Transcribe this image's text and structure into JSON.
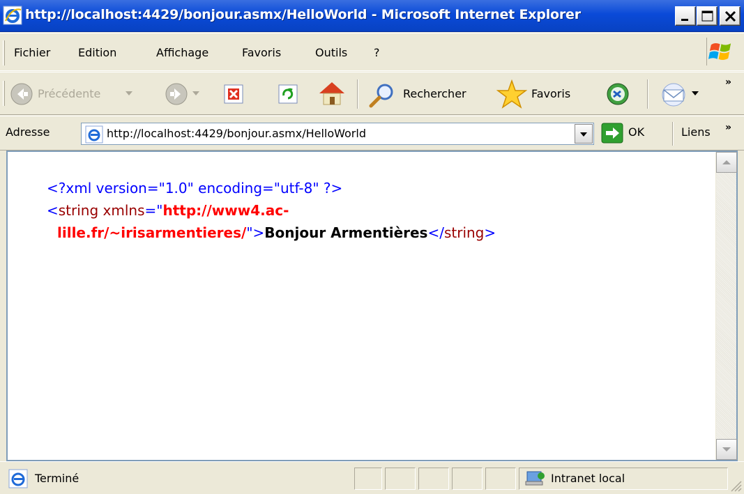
{
  "window": {
    "title": "http://localhost:4429/bonjour.asmx/HelloWorld - Microsoft Internet Explorer"
  },
  "menubar": {
    "items": [
      {
        "label": "Fichier"
      },
      {
        "label": "Edition"
      },
      {
        "label": "Affichage"
      },
      {
        "label": "Favoris"
      },
      {
        "label": "Outils"
      },
      {
        "label": "?"
      }
    ]
  },
  "toolbar": {
    "back_label": "Précédente",
    "search_label": "Rechercher",
    "favorites_label": "Favoris",
    "more_chevron": "»"
  },
  "address": {
    "label": "Adresse",
    "url": "http://localhost:4429/bonjour.asmx/HelloWorld",
    "go_label": "OK",
    "links_label": "Liens",
    "links_chevron": "»"
  },
  "content": {
    "xml_decl": "<?xml version=\"1.0\" encoding=\"utf-8\" ?>",
    "open_tag_start": "<",
    "element_name": "string",
    "attr_name": " xmlns",
    "attr_eq_quote": "=\"",
    "attr_value_part1": "http://www4.ac-",
    "attr_value_part2": "lille.fr/~irisarmentieres/",
    "attr_close_quote": "\"",
    "open_tag_end": ">",
    "text_value": "Bonjour Armentières",
    "close_tag_start": "</",
    "close_element_name": "string",
    "close_tag_end": ">"
  },
  "statusbar": {
    "status": "Terminé",
    "zone": "Intranet local"
  },
  "colors": {
    "titlebar": "#0a4ad8",
    "xml_markup": "#0000ff",
    "xml_element": "#990000",
    "xml_attr_value": "#ff0000"
  }
}
